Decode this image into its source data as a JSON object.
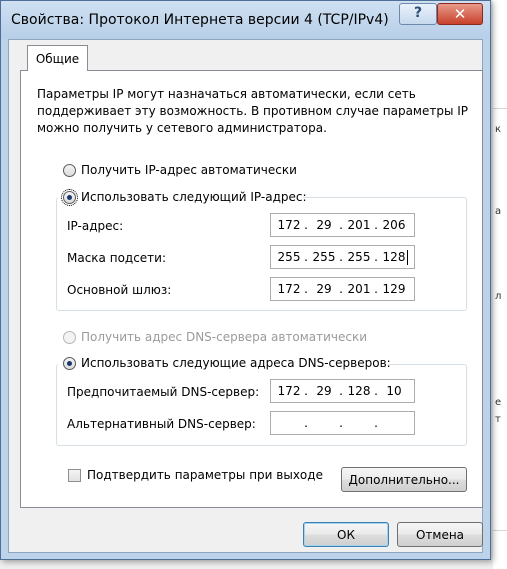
{
  "window": {
    "title": "Свойства: Протокол Интернета версии 4 (TCP/IPv4)",
    "help_glyph": "?",
    "close_glyph": "✕"
  },
  "tabs": [
    {
      "label": "Общие",
      "selected": true
    }
  ],
  "description": "Параметры IP могут назначаться автоматически, если сеть поддерживает эту возможность. В противном случае параметры IP можно получить у сетевого администратора.",
  "ip_mode": {
    "auto_label": "Получить IP-адрес автоматически",
    "manual_label": "Использовать следующий IP-адрес:",
    "selected": "manual"
  },
  "ip_fields": {
    "ip": {
      "label": "IP-адрес:",
      "octets": [
        "172",
        "29",
        "201",
        "206"
      ]
    },
    "mask": {
      "label": "Маска подсети:",
      "octets": [
        "255",
        "255",
        "255",
        "128"
      ]
    },
    "gateway": {
      "label": "Основной шлюз:",
      "octets": [
        "172",
        "29",
        "201",
        "129"
      ]
    }
  },
  "dns_mode": {
    "auto_label": "Получить адрес DNS-сервера автоматически",
    "manual_label": "Использовать следующие адреса DNS-серверов:",
    "selected": "manual",
    "auto_disabled": true
  },
  "dns_fields": {
    "preferred": {
      "label": "Предпочитаемый DNS-сервер:",
      "octets": [
        "172",
        "29",
        "128",
        "10"
      ]
    },
    "alternate": {
      "label": "Альтернативный DNS-сервер:",
      "octets": [
        "",
        "",
        "",
        ""
      ]
    }
  },
  "ip_separator": ".",
  "validate_on_exit": {
    "label": "Подтвердить параметры при выходе",
    "checked": false
  },
  "buttons": {
    "advanced": "Дополнительно...",
    "ok": "ОК",
    "cancel": "Отмена"
  },
  "background_fragments": [
    "к",
    "а",
    "л",
    "е",
    "т"
  ],
  "colors": {
    "title_bar": "#c4d8ee",
    "close_button": "#c8412b",
    "selected_radio": "#1b3a6b"
  }
}
